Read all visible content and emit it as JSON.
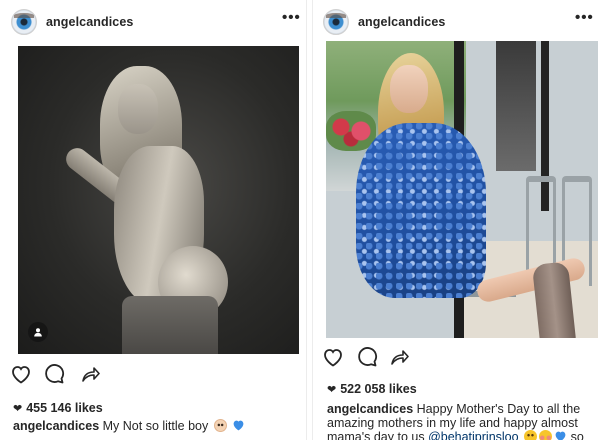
{
  "posts": [
    {
      "username": "angelcandices",
      "more_label": "•••",
      "likes": "455 146 likes",
      "caption_user": "angelcandices",
      "caption_text": "My Not so little boy",
      "icons": {
        "avatar": "profile-eye-avatar",
        "more": "more-options-icon",
        "tag": "user-tag-icon",
        "like": "heart-outline-icon",
        "comment": "comment-bubble-icon",
        "share": "share-arrow-icon",
        "emojis": [
          "baby-emoji",
          "blue-heart-emoji"
        ]
      }
    },
    {
      "username": "angelcandices",
      "more_label": "•••",
      "likes": "522 058 likes",
      "caption_user": "angelcandices",
      "caption_text": "Happy Mother's Day to all the amazing mothers in my life and happy almost mama's day to us",
      "caption_mention": "@behatiprinsloo",
      "caption_tail": "so much",
      "icons": {
        "avatar": "profile-eye-avatar",
        "more": "more-options-icon",
        "like": "heart-outline-icon",
        "comment": "comment-bubble-icon",
        "share": "share-arrow-icon",
        "emojis": [
          "kiss-emoji",
          "blush-emoji",
          "blue-heart-emoji"
        ]
      }
    }
  ],
  "colors": {
    "text": "#262626",
    "mention": "#003569",
    "blue_heart": "#3b8ee6",
    "background": "#ffffff"
  }
}
